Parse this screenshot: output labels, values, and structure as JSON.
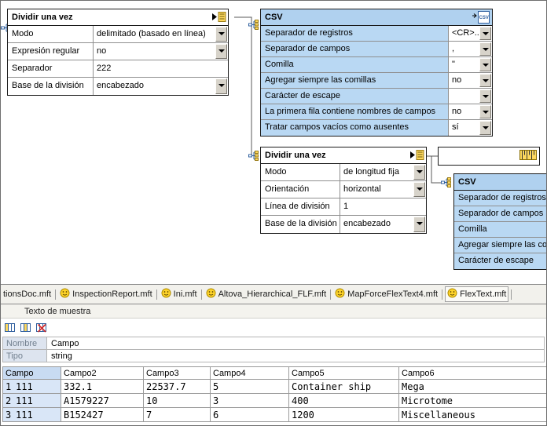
{
  "diagram": {
    "split1": {
      "title": "Dividir una vez",
      "rows": [
        {
          "label": "Modo",
          "value": "delimitado (basado en línea)"
        },
        {
          "label": "Expresión regular",
          "value": "no"
        },
        {
          "label": "Separador",
          "value": "222"
        },
        {
          "label": "Base de la división",
          "value": "encabezado"
        }
      ]
    },
    "csv1": {
      "title": "CSV",
      "rows": [
        {
          "label": "Separador de registros",
          "value": "<CR>..."
        },
        {
          "label": "Separador de campos",
          "value": ","
        },
        {
          "label": "Comilla",
          "value": "\""
        },
        {
          "label": "Agregar siempre las comillas",
          "value": "no"
        },
        {
          "label": "Carácter de escape",
          "value": ""
        },
        {
          "label": "La primera fila contiene nombres de campos",
          "value": "no"
        },
        {
          "label": "Tratar campos vacíos como ausentes",
          "value": "sí"
        }
      ]
    },
    "split2": {
      "title": "Dividir una vez",
      "rows": [
        {
          "label": "Modo",
          "value": "de longitud fija"
        },
        {
          "label": "Orientación",
          "value": "horizontal"
        },
        {
          "label": "Línea de división",
          "value": "1"
        },
        {
          "label": "Base de la división",
          "value": "encabezado"
        }
      ]
    },
    "csv2": {
      "title": "CSV",
      "labels": [
        "Separador de registros",
        "Separador de campos",
        "Comilla",
        "Agregar siempre las comillas",
        "Carácter de escape"
      ]
    }
  },
  "tabbar": {
    "tabs": [
      {
        "label": "tionsDoc.mft"
      },
      {
        "label": "InspectionReport.mft"
      },
      {
        "label": "Ini.mft"
      },
      {
        "label": "Altova_Hierarchical_FLF.mft"
      },
      {
        "label": "MapForceFlexText4.mft"
      },
      {
        "label": "FlexText.mft"
      }
    ]
  },
  "sample": {
    "title": "Texto de muestra",
    "fields": {
      "name_label": "Nombre",
      "name_value": "Campo",
      "type_label": "Tipo",
      "type_value": "string"
    },
    "table": {
      "headers": [
        "Campo",
        "Campo2",
        "Campo3",
        "Campo4",
        "Campo5",
        "Campo6"
      ],
      "rows": [
        {
          "num": "1",
          "c1": "111",
          "c2": "332.1",
          "c3": "22537.7",
          "c4": "5",
          "c5": "Container ship",
          "c6": "Mega"
        },
        {
          "num": "2",
          "c1": "111",
          "c2": "A1579227",
          "c3": "10",
          "c4": "3",
          "c5": "400",
          "c6": "Microtome"
        },
        {
          "num": "3",
          "c1": "111",
          "c2": "B152427",
          "c3": "7",
          "c4": "6",
          "c5": "1200",
          "c6": "Miscellaneous"
        }
      ]
    }
  },
  "colors": {
    "csv_header": "#b0d1ef",
    "csv_label": "#b9d8f3",
    "selection": "#d9e6f7"
  }
}
